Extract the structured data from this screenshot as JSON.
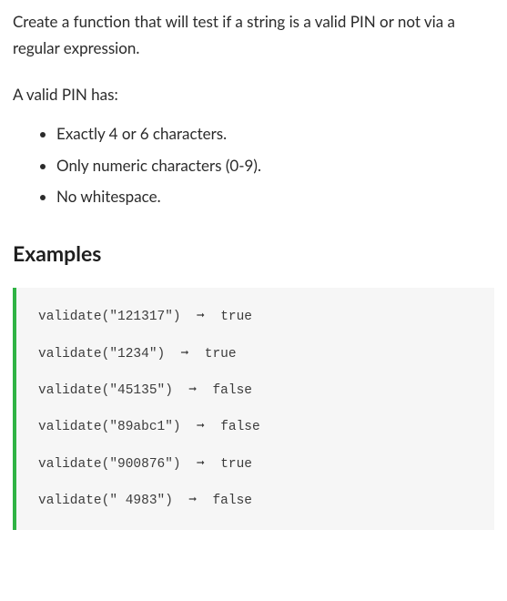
{
  "intro": "Create a function that will test if a string is a valid PIN or not via a regular expression.",
  "subhead": "A valid PIN has:",
  "rules": [
    "Exactly 4 or 6 characters.",
    "Only numeric characters (0-9).",
    "No whitespace."
  ],
  "examples_heading": "Examples",
  "examples": [
    {
      "call": "validate(\"121317\")",
      "result": "true"
    },
    {
      "call": "validate(\"1234\")",
      "result": "true"
    },
    {
      "call": "validate(\"45135\")",
      "result": "false"
    },
    {
      "call": "validate(\"89abc1\")",
      "result": "false"
    },
    {
      "call": "validate(\"900876\")",
      "result": "true"
    },
    {
      "call": "validate(\" 4983\")",
      "result": "false"
    }
  ],
  "arrow": "➞"
}
